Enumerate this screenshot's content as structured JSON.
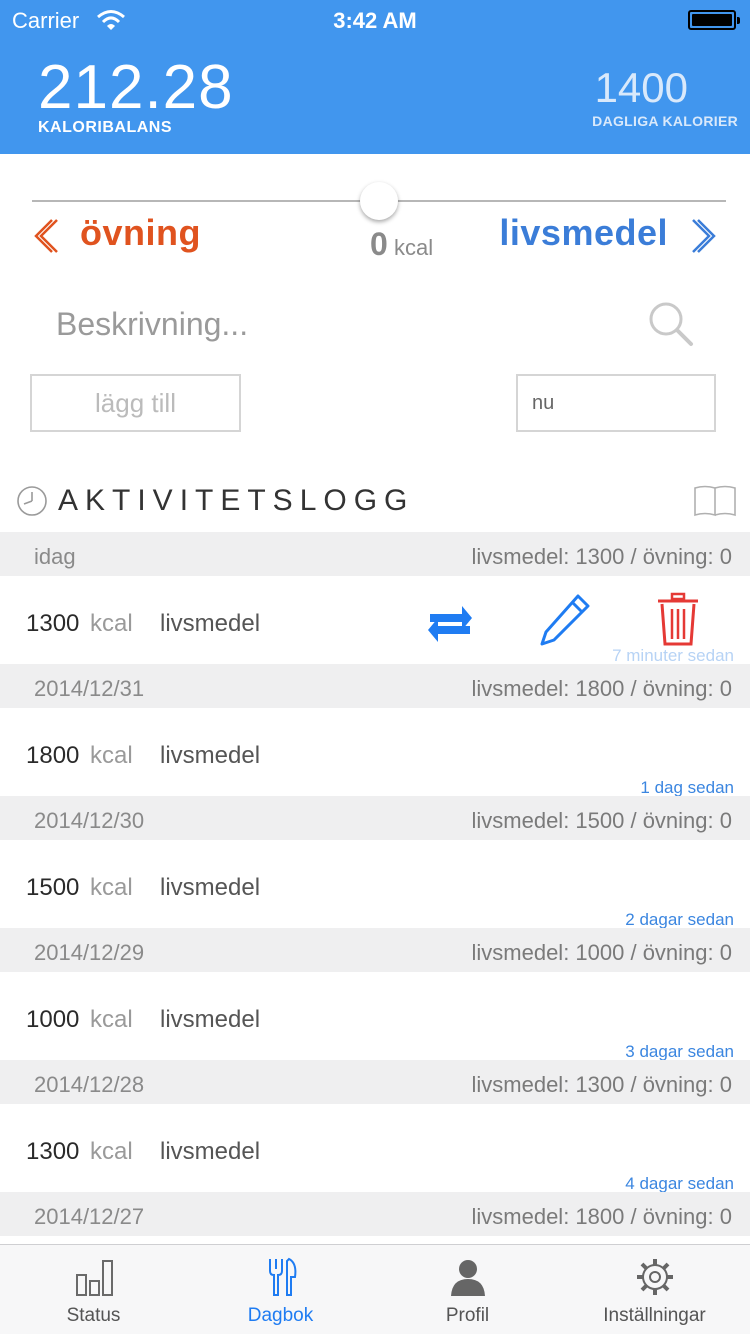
{
  "status_bar": {
    "carrier": "Carrier",
    "time": "3:42 AM"
  },
  "header": {
    "balance_value": "212.28",
    "balance_label": "KALORIBALANS",
    "daily_value": "1400",
    "daily_label": "DAGLIGA KALORIER",
    "accent_color": "#4196ee"
  },
  "entry": {
    "exercise_label": "övning",
    "food_label": "livsmedel",
    "kcal_value": "0",
    "kcal_unit": "kcal",
    "slider_fraction": 0.5,
    "description_placeholder": "Beskrivning...",
    "add_button_label": "lägg till",
    "time_value": "nu",
    "exercise_color": "#e0531f",
    "food_color": "#3b7dd8"
  },
  "log": {
    "title": "AKTIVITETSLOGG",
    "sections": [
      {
        "date": "idag",
        "totals": "livsmedel: 1300 / övning: 0",
        "entry": {
          "amount": "1300",
          "unit": "kcal",
          "kind": "livsmedel",
          "ago": "7 minuter sedan"
        }
      },
      {
        "date": "2014/12/31",
        "totals": "livsmedel: 1800 / övning: 0",
        "entry": {
          "amount": "1800",
          "unit": "kcal",
          "kind": "livsmedel",
          "ago": "1 dag sedan"
        }
      },
      {
        "date": "2014/12/30",
        "totals": "livsmedel: 1500 / övning: 0",
        "entry": {
          "amount": "1500",
          "unit": "kcal",
          "kind": "livsmedel",
          "ago": "2 dagar sedan"
        }
      },
      {
        "date": "2014/12/29",
        "totals": "livsmedel: 1000 / övning: 0",
        "entry": {
          "amount": "1000",
          "unit": "kcal",
          "kind": "livsmedel",
          "ago": "3 dagar sedan"
        }
      },
      {
        "date": "2014/12/28",
        "totals": "livsmedel: 1300 / övning: 0",
        "entry": {
          "amount": "1300",
          "unit": "kcal",
          "kind": "livsmedel",
          "ago": "4 dagar sedan"
        }
      },
      {
        "date": "2014/12/27",
        "totals": "livsmedel: 1800 / övning: 0"
      }
    ]
  },
  "tabs": [
    {
      "label": "Status",
      "icon": "bar-chart-icon"
    },
    {
      "label": "Dagbok",
      "icon": "fork-knife-icon",
      "active": true
    },
    {
      "label": "Profil",
      "icon": "person-icon"
    },
    {
      "label": "Inställningar",
      "icon": "gear-icon"
    }
  ]
}
